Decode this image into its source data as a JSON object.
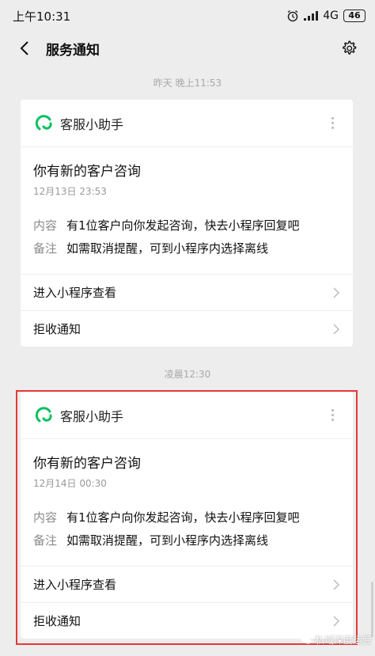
{
  "status_bar": {
    "time": "上午10:31",
    "network": "4G",
    "battery": "46"
  },
  "nav": {
    "title": "服务通知"
  },
  "dividers": [
    "昨天 晚上11:53",
    "凌晨12:30"
  ],
  "cards": [
    {
      "app_name": "客服小助手",
      "title": "你有新的客户咨询",
      "date": "12月13日  23:53",
      "content_label": "内容",
      "content_value": "有1位客户向你发起咨询，快去小程序回复吧",
      "note_label": "备注",
      "note_value": "如需取消提醒，可到小程序内选择离线",
      "action_open": "进入小程序查看",
      "action_reject": "拒收通知"
    },
    {
      "app_name": "客服小助手",
      "title": "你有新的客户咨询",
      "date": "12月14日  00:30",
      "content_label": "内容",
      "content_value": "有1位客户向你发起咨询，快去小程序回复吧",
      "note_label": "备注",
      "note_value": "如需取消提醒，可到小程序内选择离线",
      "action_open": "进入小程序查看",
      "action_reject": "拒收通知"
    }
  ],
  "watermark": "私域深度运营",
  "colors": {
    "background": "#ededed",
    "card": "#ffffff",
    "logo_green": "#07c160",
    "highlight_red": "#e53935"
  },
  "icons": {
    "back": "chevron-left-icon",
    "settings": "gear-icon",
    "app_logo": "service-bubble-icon",
    "more": "more-vertical-icon",
    "row_arrow": "chevron-right-icon"
  }
}
